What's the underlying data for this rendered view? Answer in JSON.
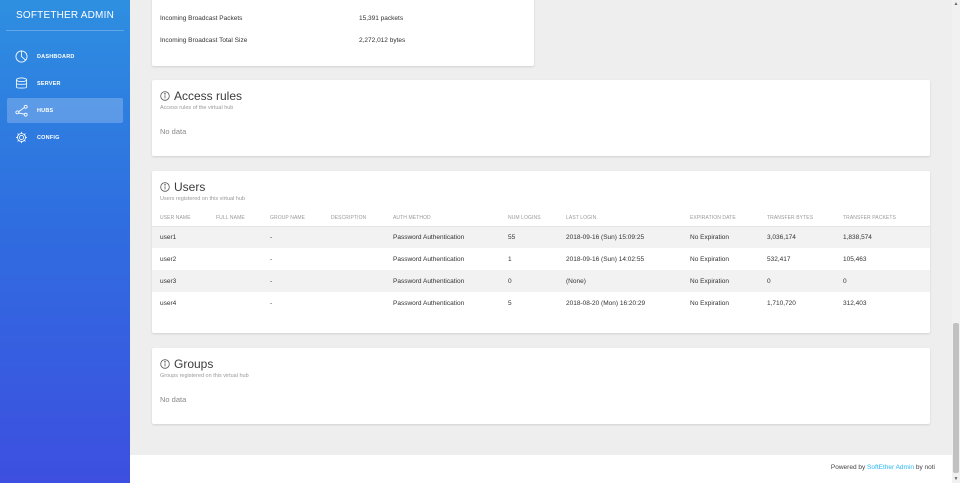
{
  "sidebar": {
    "brand": "SOFTETHER ADMIN",
    "items": [
      {
        "label": "DASHBOARD",
        "icon": "pie-chart-icon",
        "active": false
      },
      {
        "label": "SERVER",
        "icon": "database-icon",
        "active": false
      },
      {
        "label": "HUBS",
        "icon": "share-icon",
        "active": true
      },
      {
        "label": "CONFIG",
        "icon": "gear-icon",
        "active": false
      }
    ]
  },
  "stats": {
    "rows": [
      {
        "key": "Incoming Broadcast Packets",
        "value": "15,391 packets"
      },
      {
        "key": "Incoming Broadcast Total Size",
        "value": "2,272,012 bytes"
      }
    ]
  },
  "access_rules": {
    "title": "Access rules",
    "subtitle": "Access rules of the virtual hub",
    "empty": "No data"
  },
  "users": {
    "title": "Users",
    "subtitle": "Users registered on this virtual hub",
    "columns": [
      "USER NAME",
      "FULL NAME",
      "GROUP NAME",
      "DESCRIPTION",
      "AUTH METHOD",
      "NUM LOGINS",
      "LAST LOGIN",
      "EXPIRATION DATE",
      "TRANSFER BYTES",
      "TRANSFER PACKETS"
    ],
    "rows": [
      [
        "user1",
        "",
        "-",
        "",
        "Password Authentication",
        "55",
        "2018-09-16 (Sun) 15:09:25",
        "No Expiration",
        "3,036,174",
        "1,838,574"
      ],
      [
        "user2",
        "",
        "-",
        "",
        "Password Authentication",
        "1",
        "2018-09-16 (Sun) 14:02:55",
        "No Expiration",
        "532,417",
        "105,463"
      ],
      [
        "user3",
        "",
        "-",
        "",
        "Password Authentication",
        "0",
        "(None)",
        "No Expiration",
        "0",
        "0"
      ],
      [
        "user4",
        "",
        "-",
        "",
        "Password Authentication",
        "5",
        "2018-08-20 (Mon) 16:20:29",
        "No Expiration",
        "1,710,720",
        "312,403"
      ]
    ]
  },
  "groups": {
    "title": "Groups",
    "subtitle": "Groups registered on this virtual hub",
    "empty": "No data"
  },
  "footer": {
    "prefix": "Powered by ",
    "link": "SoftEther Admin",
    "suffix": " by noti"
  },
  "colors": {
    "sidebar_top": "#2e8fe0",
    "sidebar_bottom": "#3d4fe0",
    "link": "#29b6f6"
  }
}
